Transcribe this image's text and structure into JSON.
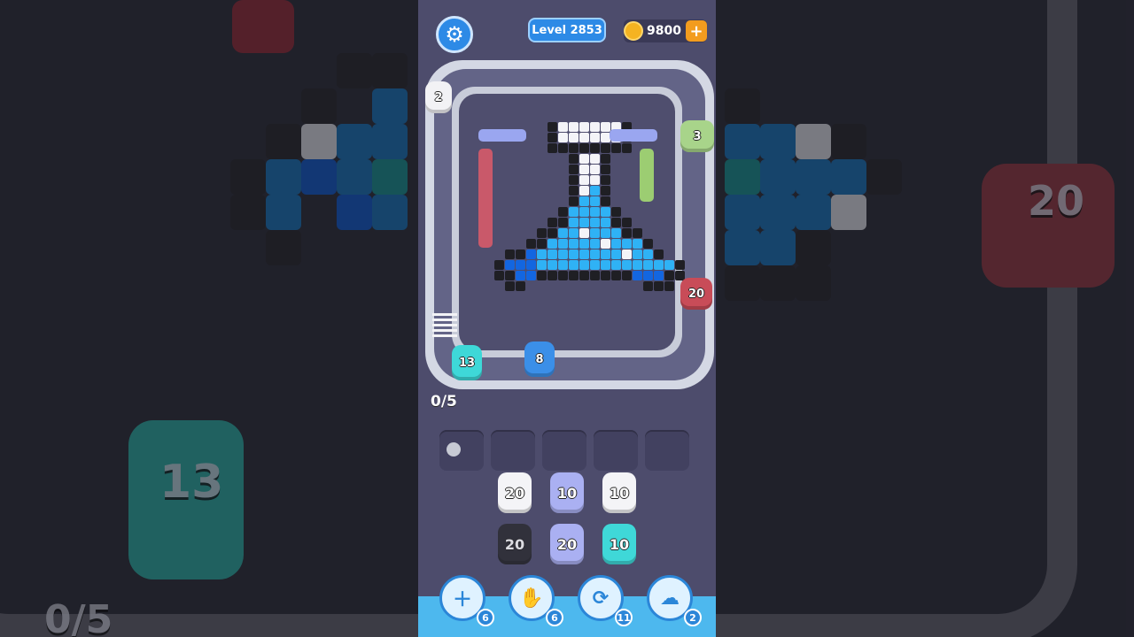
{
  "header": {
    "level_label": "Level 2853",
    "coins": "9800",
    "coin_plus": "+",
    "settings_icon": "gear-icon"
  },
  "board": {
    "top_pig": {
      "count": "2",
      "color": "#f2f2f5"
    },
    "right_top_pig": {
      "count": "3",
      "color": "#a8d48a"
    },
    "right_pig": {
      "count": "20",
      "color": "#c84c58"
    },
    "bottom_left_pig": {
      "count": "13",
      "color": "#3ed8d8"
    },
    "bottom_pig": {
      "count": "8",
      "color": "#3b8fe8"
    },
    "progress": "0/5"
  },
  "queue": [
    {
      "count": "20",
      "color": "#f4f4f7"
    },
    {
      "count": "10",
      "color": "#aab0f2"
    },
    {
      "count": "10",
      "color": "#f4f4f7"
    },
    {
      "count": "20",
      "color": "#2b2b30"
    },
    {
      "count": "20",
      "color": "#aab0f2"
    },
    {
      "count": "10",
      "color": "#3fd8d8"
    }
  ],
  "boosters": [
    {
      "icon": "add-slot-icon",
      "count": "6"
    },
    {
      "icon": "hand-icon",
      "count": "6"
    },
    {
      "icon": "shuffle-icon",
      "count": "11"
    },
    {
      "icon": "ghost-icon",
      "count": "2"
    }
  ],
  "background": {
    "left_pig_count": "13",
    "left_progress": "0/5",
    "right_pig_count": "20"
  },
  "colors": {
    "phone_bg": "#4d4c6c",
    "accent_blue": "#2d8ae6",
    "bottom_bar": "#4db8ee"
  }
}
